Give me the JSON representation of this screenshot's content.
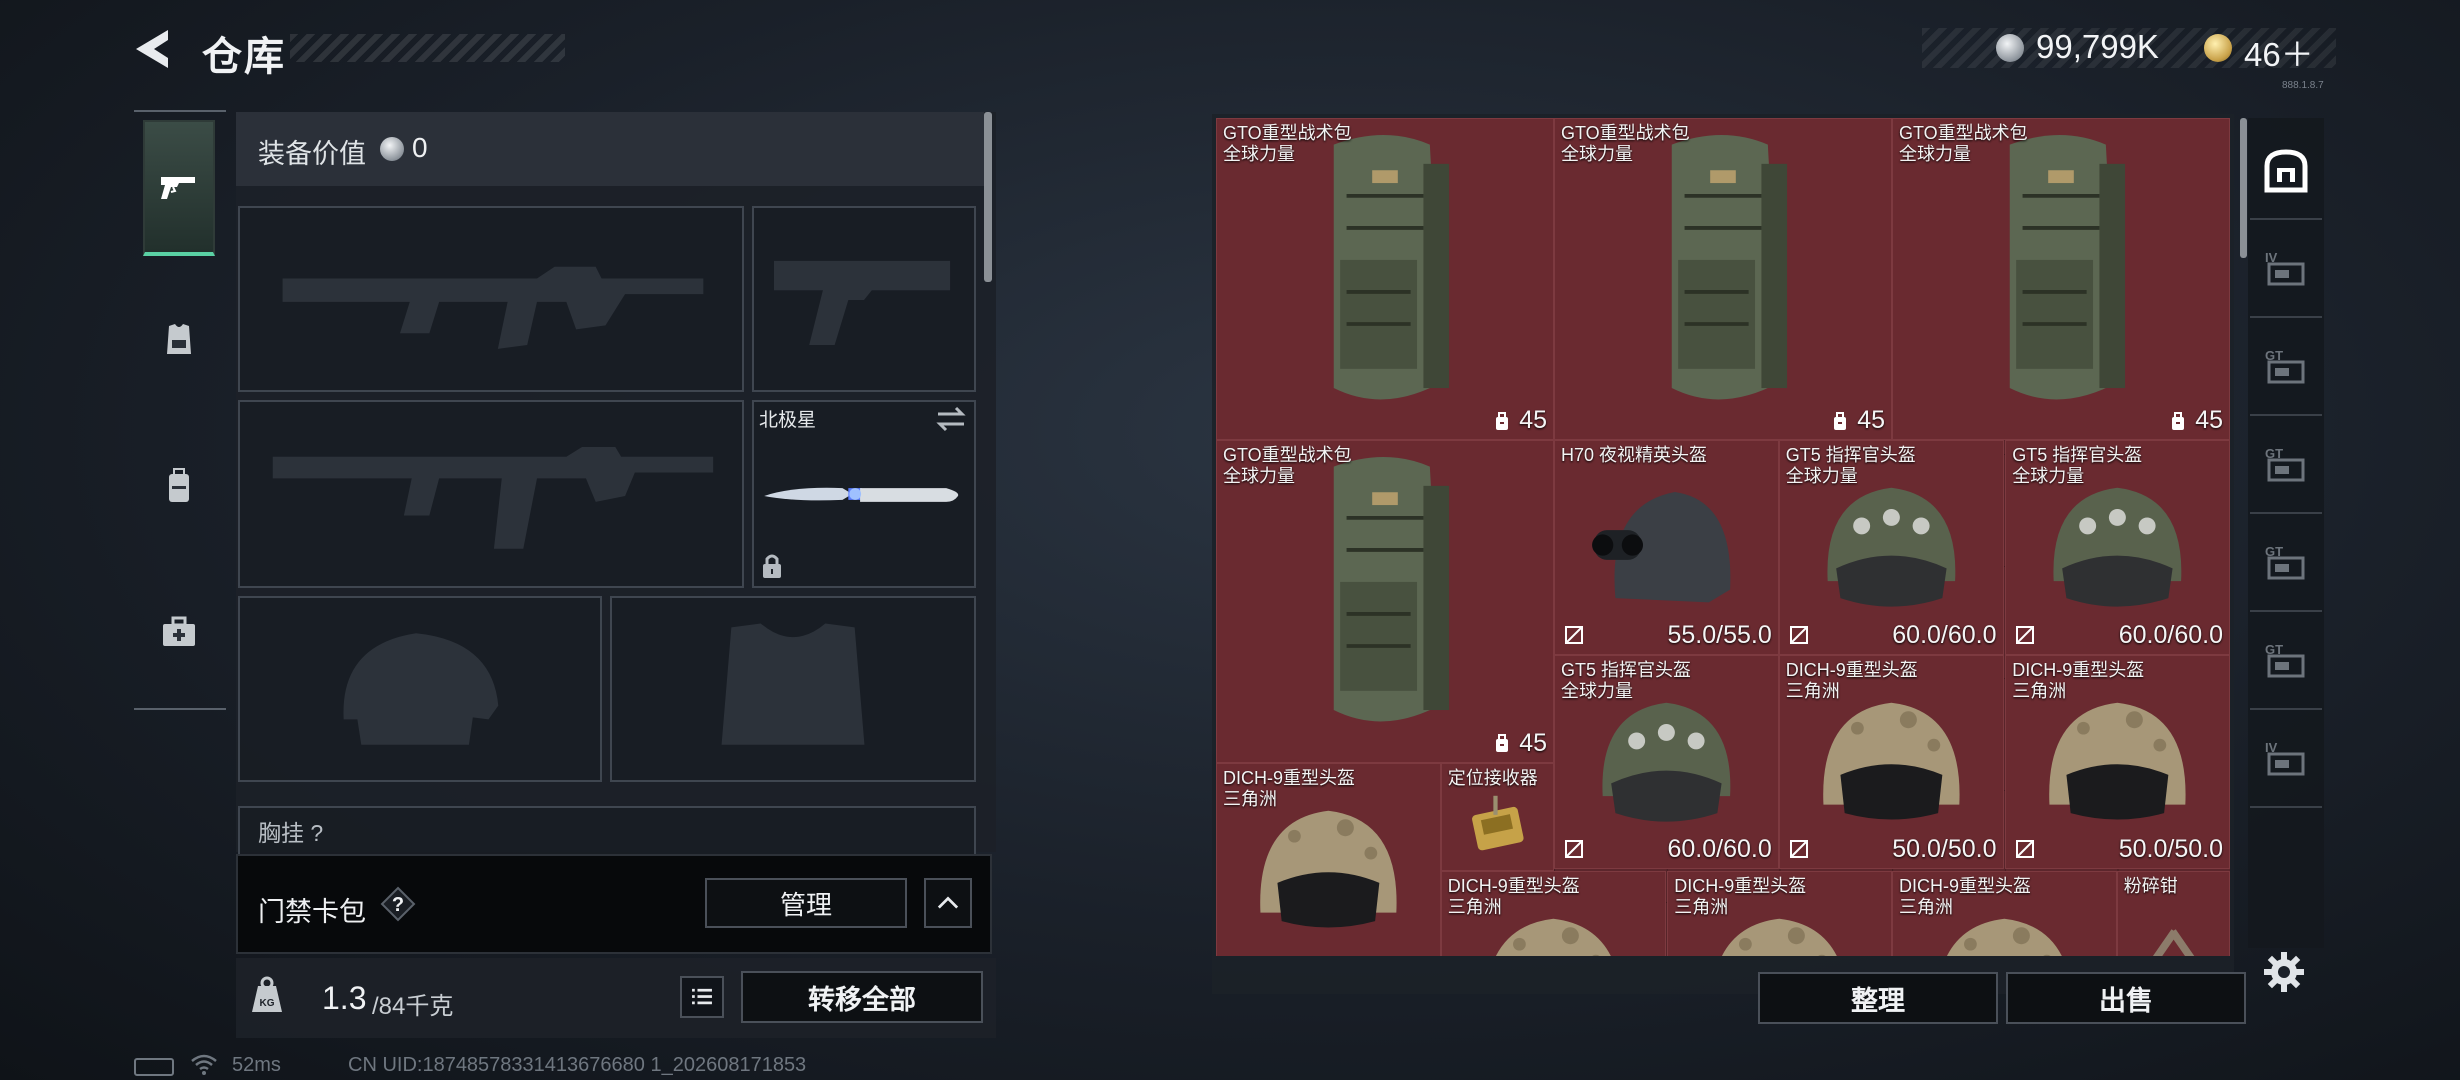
{
  "header": {
    "title": "仓库",
    "currency_primary": "99,799K",
    "currency_secondary": "46＋",
    "version_tiny": "888.1.8.7"
  },
  "tabs": [
    {
      "name": "weapon",
      "icon": "pistol-icon",
      "active": true
    },
    {
      "name": "armor",
      "icon": "armor-vest-icon",
      "active": false
    },
    {
      "name": "backpack",
      "icon": "backpack-icon",
      "active": false
    },
    {
      "name": "case",
      "icon": "medkit-case-icon",
      "active": false
    }
  ],
  "equipment": {
    "label": "装备价值",
    "value": "0",
    "melee_name": "北极星",
    "chest_rig_label": "胸挂 ?"
  },
  "card_pack": {
    "label": "门禁卡包",
    "manage_label": "管理"
  },
  "footer_left": {
    "weight": "1.3",
    "capacity": "/84千克",
    "transfer_label": "转移全部"
  },
  "stash": {
    "sort_label": "整理",
    "sell_label": "出售",
    "items": [
      {
        "name": "GTO重型战术包\n全球力量",
        "type": "backpack",
        "badge": "45",
        "durability": ""
      },
      {
        "name": "GTO重型战术包\n全球力量",
        "type": "backpack",
        "badge": "45",
        "durability": ""
      },
      {
        "name": "GTO重型战术包\n全球力量",
        "type": "backpack",
        "badge": "45",
        "durability": ""
      },
      {
        "name": "GTO重型战术包\n全球力量",
        "type": "backpack",
        "badge": "45",
        "durability": ""
      },
      {
        "name": "H70 夜视精英头盔",
        "type": "nv-helmet",
        "badge": "",
        "durability": "55.0/55.0"
      },
      {
        "name": "GT5 指挥官头盔\n全球力量",
        "type": "helmet-green",
        "badge": "",
        "durability": "60.0/60.0"
      },
      {
        "name": "GT5 指挥官头盔\n全球力量",
        "type": "helmet-green",
        "badge": "",
        "durability": "60.0/60.0"
      },
      {
        "name": "GT5 指挥官头盔\n全球力量",
        "type": "helmet-green",
        "badge": "",
        "durability": "60.0/60.0"
      },
      {
        "name": "DICH-9重型头盔\n三角洲",
        "type": "helmet-tan",
        "badge": "",
        "durability": "50.0/50.0"
      },
      {
        "name": "DICH-9重型头盔\n三角洲",
        "type": "helmet-tan",
        "badge": "",
        "durability": "50.0/50.0"
      },
      {
        "name": "DICH-9重型头盔\n三角洲",
        "type": "helmet-tan",
        "badge": "",
        "durability": ""
      },
      {
        "name": "定位接收器",
        "type": "receiver",
        "badge": "",
        "durability": ""
      },
      {
        "name": "DICH-9重型头盔\n三角洲",
        "type": "helmet-tan",
        "badge": "",
        "durability": ""
      },
      {
        "name": "DICH-9重型头盔\n三角洲",
        "type": "helmet-tan",
        "badge": "",
        "durability": ""
      },
      {
        "name": "DICH-9重型头盔\n三角洲",
        "type": "helmet-tan",
        "badge": "",
        "durability": ""
      },
      {
        "name": "粉碎钳",
        "type": "pliers",
        "badge": "",
        "durability": ""
      }
    ]
  },
  "side_tabs": [
    "safe-icon",
    "stash-iv-icon",
    "stash-gt-icon",
    "stash-gt-icon",
    "stash-gt-icon",
    "stash-gt-icon",
    "stash-iv-icon"
  ],
  "status": {
    "ping": "52ms",
    "uid": "CN UID:18748578331413676680 1_202608171853"
  },
  "colors": {
    "accent": "#5ad1a4",
    "stash_bg": "#5c262c",
    "panel": "#1c2128"
  }
}
